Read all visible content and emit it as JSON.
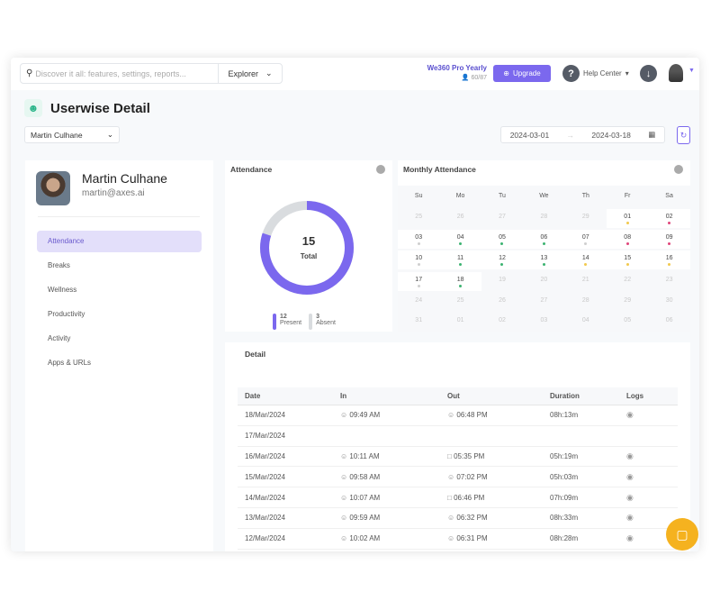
{
  "topbar": {
    "search_placeholder": "Discover it all: features, settings, reports...",
    "explorer": "Explorer",
    "plan": "We360 Pro Yearly",
    "seats": "60/87",
    "upgrade": "Upgrade",
    "help": "Help Center"
  },
  "page": {
    "title": "Userwise Detail",
    "user_select": "Martin Culhane",
    "date_from": "2024-03-01",
    "date_to": "2024-03-18"
  },
  "profile": {
    "name": "Martin Culhane",
    "email": "martin@axes.ai"
  },
  "nav": [
    {
      "label": "Attendance",
      "active": true
    },
    {
      "label": "Breaks"
    },
    {
      "label": "Wellness"
    },
    {
      "label": "Productivity"
    },
    {
      "label": "Activity"
    },
    {
      "label": "Apps & URLs"
    }
  ],
  "attendance": {
    "title": "Attendance",
    "total": "15",
    "total_label": "Total",
    "present": "12",
    "present_label": "Present",
    "absent": "3",
    "absent_label": "Absent",
    "colors": {
      "present": "#7b68ee",
      "absent": "#d9dcdf"
    }
  },
  "chart_data": {
    "type": "pie",
    "variant": "donut",
    "categories": [
      "Present",
      "Absent"
    ],
    "values": [
      12,
      3
    ]
  },
  "calendar": {
    "title": "Monthly Attendance",
    "weekdays": [
      "Su",
      "Mo",
      "Tu",
      "We",
      "Th",
      "Fr",
      "Sa"
    ],
    "weeks": [
      [
        [
          "25",
          ""
        ],
        [
          "26",
          ""
        ],
        [
          "27",
          ""
        ],
        [
          "28",
          ""
        ],
        [
          "29",
          ""
        ],
        [
          "01",
          "yellow"
        ],
        [
          "02",
          "red"
        ]
      ],
      [
        [
          "03",
          "gray"
        ],
        [
          "04",
          "green"
        ],
        [
          "05",
          "green"
        ],
        [
          "06",
          "green"
        ],
        [
          "07",
          "gray"
        ],
        [
          "08",
          "red"
        ],
        [
          "09",
          "red"
        ]
      ],
      [
        [
          "10",
          "gray"
        ],
        [
          "11",
          "green"
        ],
        [
          "12",
          "green"
        ],
        [
          "13",
          "green"
        ],
        [
          "14",
          "yellow"
        ],
        [
          "15",
          "yellow"
        ],
        [
          "16",
          "yellow"
        ]
      ],
      [
        [
          "17",
          "gray"
        ],
        [
          "18",
          "green"
        ],
        [
          "19",
          ""
        ],
        [
          "20",
          ""
        ],
        [
          "21",
          ""
        ],
        [
          "22",
          ""
        ],
        [
          "23",
          ""
        ]
      ],
      [
        [
          "24",
          ""
        ],
        [
          "25",
          ""
        ],
        [
          "26",
          ""
        ],
        [
          "27",
          ""
        ],
        [
          "28",
          ""
        ],
        [
          "29",
          ""
        ],
        [
          "30",
          ""
        ]
      ],
      [
        [
          "31",
          ""
        ],
        [
          "01",
          ""
        ],
        [
          "02",
          ""
        ],
        [
          "03",
          ""
        ],
        [
          "04",
          ""
        ],
        [
          "05",
          ""
        ],
        [
          "06",
          ""
        ]
      ]
    ],
    "dot_colors": {
      "green": "#3cb371",
      "yellow": "#f2c94c",
      "red": "#e0457b",
      "gray": "#cfcfcf"
    }
  },
  "detail": {
    "title": "Detail",
    "columns": [
      "Date",
      "In",
      "Out",
      "Duration",
      "Logs"
    ],
    "rows": [
      {
        "date": "18/Mar/2024",
        "in": "09:49 AM",
        "in_icon": "user",
        "out": "06:48 PM",
        "out_icon": "user",
        "duration": "08h:13m",
        "logs": true
      },
      {
        "date": "17/Mar/2024",
        "in": "",
        "out": "",
        "duration": "",
        "logs": false
      },
      {
        "date": "16/Mar/2024",
        "in": "10:11 AM",
        "in_icon": "user",
        "out": "05:35 PM",
        "out_icon": "monitor",
        "duration": "05h:19m",
        "logs": true
      },
      {
        "date": "15/Mar/2024",
        "in": "09:58 AM",
        "in_icon": "user",
        "out": "07:02 PM",
        "out_icon": "user",
        "duration": "05h:03m",
        "logs": true
      },
      {
        "date": "14/Mar/2024",
        "in": "10:07 AM",
        "in_icon": "user",
        "out": "06:46 PM",
        "out_icon": "monitor",
        "duration": "07h:09m",
        "logs": true
      },
      {
        "date": "13/Mar/2024",
        "in": "09:59 AM",
        "in_icon": "user",
        "out": "06:32 PM",
        "out_icon": "user",
        "duration": "08h:33m",
        "logs": true
      },
      {
        "date": "12/Mar/2024",
        "in": "10:02 AM",
        "in_icon": "user",
        "out": "06:31 PM",
        "out_icon": "user",
        "duration": "08h:28m",
        "logs": true
      }
    ]
  }
}
